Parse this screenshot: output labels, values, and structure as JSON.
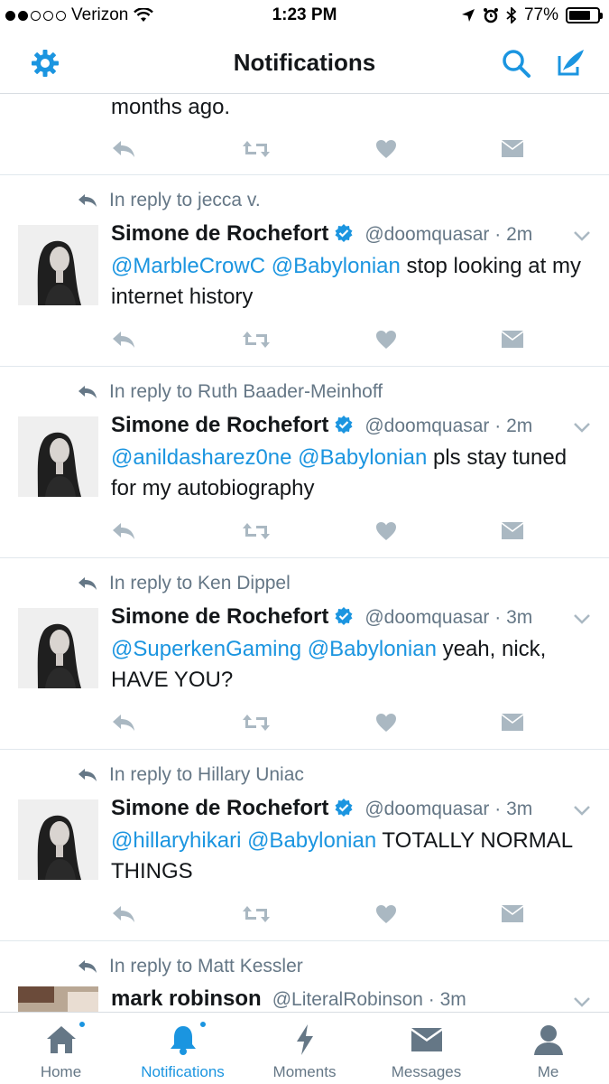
{
  "status_bar": {
    "carrier": "Verizon",
    "time": "1:23 PM",
    "battery": "77%",
    "battery_level": 0.77,
    "signal_bars_filled": 2,
    "signal_bars_total": 5
  },
  "nav": {
    "title": "Notifications",
    "left_icon": "gear-icon",
    "right_icons": [
      "search-icon",
      "compose-icon"
    ]
  },
  "feed": {
    "top_partial": {
      "text": "months ago."
    },
    "tweets": [
      {
        "reply_to": "In reply to jecca v.",
        "name": "Simone de Rochefort",
        "verified": true,
        "handle": "@doomquasar · 2m",
        "mentions": "@MarbleCrowC @Babylonian",
        "text": " stop looking at my internet history"
      },
      {
        "reply_to": "In reply to Ruth Baader-Meinhoff",
        "name": "Simone de Rochefort",
        "verified": true,
        "handle": "@doomquasar · 2m",
        "mentions": "@anildasharez0ne @Babylonian",
        "text": " pls stay tuned for my autobiography"
      },
      {
        "reply_to": "In reply to Ken Dippel",
        "name": "Simone de Rochefort",
        "verified": true,
        "handle": "@doomquasar · 3m",
        "mentions": "@SuperkenGaming @Babylonian",
        "text": " yeah, nick, HAVE YOU?"
      },
      {
        "reply_to": "In reply to Hillary Uniac",
        "name": "Simone de Rochefort",
        "verified": true,
        "handle": "@doomquasar · 3m",
        "mentions": "@hillaryhikari @Babylonian",
        "text": " TOTALLY NORMAL THINGS"
      }
    ],
    "bottom_partial": {
      "reply_to": "In reply to Matt Kessler",
      "name": "mark robinson",
      "handle": "@LiteralRobinson · 3m"
    }
  },
  "tabbar": {
    "tabs": [
      {
        "label": "Home",
        "icon": "home-icon",
        "active": false,
        "badge": true
      },
      {
        "label": "Notifications",
        "icon": "bell-icon",
        "active": true,
        "badge": true
      },
      {
        "label": "Moments",
        "icon": "lightning-icon",
        "active": false,
        "badge": false
      },
      {
        "label": "Messages",
        "icon": "envelope-icon",
        "active": false,
        "badge": false
      },
      {
        "label": "Me",
        "icon": "person-icon",
        "active": false,
        "badge": false
      }
    ]
  },
  "colors": {
    "accent": "#1b95e0",
    "icon_gray": "#aab8c2",
    "text_secondary": "#657786",
    "divider": "#e1e8ed"
  }
}
